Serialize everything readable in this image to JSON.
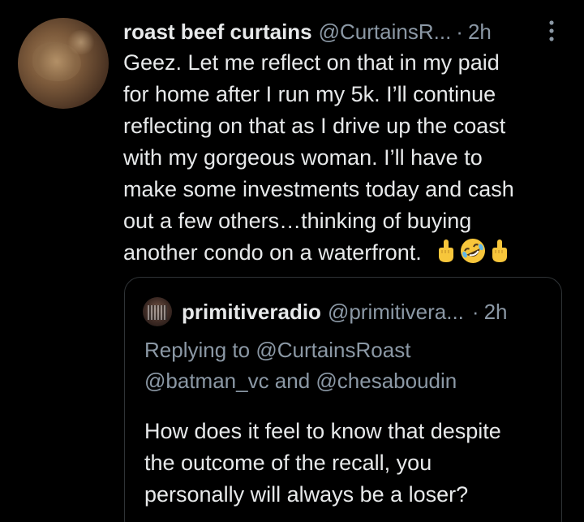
{
  "tweet": {
    "display_name": "roast beef curtains",
    "handle": "@CurtainsR...",
    "separator": "·",
    "time": "2h",
    "more_icon": "more-vertical-icon",
    "text": "Geez. Let me reflect on that in my paid\nfor home after I run my 5k.  I’ll continue\nreflecting on that as I drive up the coast\nwith my gorgeous woman.  I’ll have to\nmake some investments today and cash\nout a few others…thinking of buying\nanother condo on a waterfront.",
    "emojis": [
      "middle-finger-emoji",
      "rolling-laughing-emoji",
      "middle-finger-emoji"
    ]
  },
  "quote": {
    "display_name": "primitiveradio",
    "handle": "@primitivera...",
    "separator": "·",
    "time": "2h",
    "replying_prefix": "Replying to ",
    "replying_mention_1": "@CurtainsRoast",
    "replying_mention_2": "@batman_vc",
    "replying_and": " and ",
    "replying_mention_3": "@chesaboudin",
    "text": "How does it feel to know that despite\nthe outcome of the recall, you\npersonally will always be a loser?"
  },
  "colors": {
    "background": "#000000",
    "primary_text": "#e7e9ea",
    "secondary_text": "#8b98a5",
    "border": "#2f3336",
    "emoji_yellow": "#f7c63b"
  }
}
